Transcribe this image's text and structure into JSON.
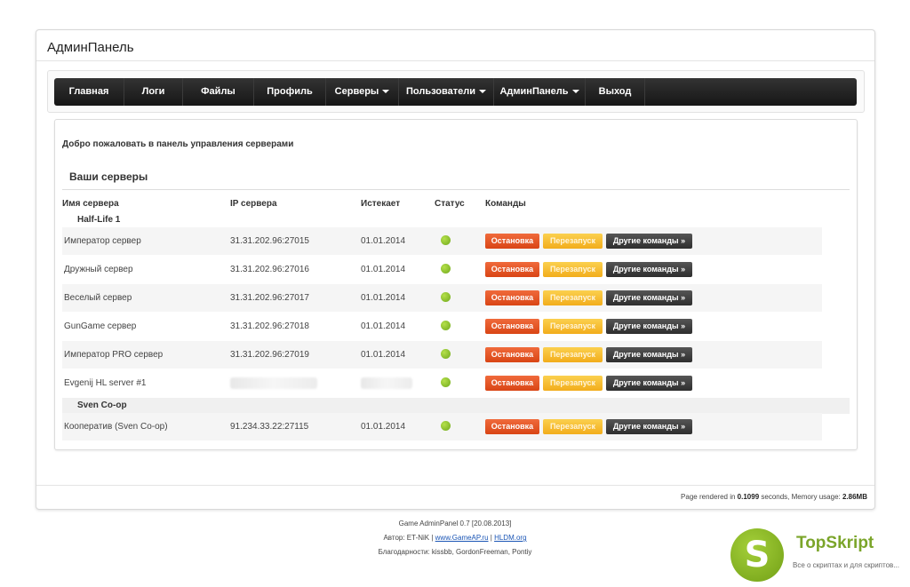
{
  "panel": {
    "title": "АдминПанель"
  },
  "nav": {
    "items": [
      {
        "label": "Главная",
        "dropdown": false
      },
      {
        "label": "Логи",
        "dropdown": false
      },
      {
        "label": "Файлы",
        "dropdown": false
      },
      {
        "label": "Профиль",
        "dropdown": false
      },
      {
        "label": "Серверы",
        "dropdown": true
      },
      {
        "label": "Пользователи",
        "dropdown": true
      },
      {
        "label": "АдминПанель",
        "dropdown": true
      },
      {
        "label": "Выход",
        "dropdown": false
      }
    ]
  },
  "content": {
    "welcome": "Добро пожаловать в панель управления серверами",
    "section_title": "Ваши серверы",
    "columns": [
      "Имя сервера",
      "IP сервера",
      "Истекает",
      "Статус",
      "Команды"
    ],
    "buttons": {
      "stop": "Остановка",
      "restart": "Перезапуск",
      "other": "Другие команды »"
    },
    "groups": [
      {
        "name": "Half-Life 1",
        "servers": [
          {
            "name": "Император сервер",
            "ip": "31.31.202.96:27015",
            "expires": "01.01.2014",
            "status": "online"
          },
          {
            "name": "Дружный сервер",
            "ip": "31.31.202.96:27016",
            "expires": "01.01.2014",
            "status": "online"
          },
          {
            "name": "Веселый сервер",
            "ip": "31.31.202.96:27017",
            "expires": "01.01.2014",
            "status": "online"
          },
          {
            "name": "GunGame сервер",
            "ip": "31.31.202.96:27018",
            "expires": "01.01.2014",
            "status": "online"
          },
          {
            "name": "Император PRO сервер",
            "ip": "31.31.202.96:27019",
            "expires": "01.01.2014",
            "status": "online"
          },
          {
            "name": "Evgenij HL server #1",
            "ip": "",
            "expires": "",
            "status": "online"
          }
        ]
      },
      {
        "name": "Sven Co-op",
        "servers": [
          {
            "name": "Кооператив (Sven Co-op)",
            "ip": "91.234.33.22:27115",
            "expires": "01.01.2014",
            "status": "online"
          }
        ]
      }
    ]
  },
  "stats": {
    "prefix": "Page rendered in",
    "time": "0.1099",
    "middle": "seconds, Memory usage:",
    "memory": "2.86MB"
  },
  "footer": {
    "version": "Game AdminPanel 0.7 [20.08.2013]",
    "author_prefix": "Автор: ET-NiK |",
    "link1": "www.GameAP.ru",
    "separator": "|",
    "link2": "HLDM.org",
    "thanks": "Благодарности: kissbb, GordonFreeman, Pontiy"
  },
  "brand": {
    "name": "TopSkript",
    "tagline": "Все о скриптах и для скриптов...",
    "logo_letter": "S"
  },
  "colors": {
    "stop": "#e0521f",
    "restart": "#f5b928",
    "other": "#3a3a3a",
    "status_online": "#8cc63f"
  }
}
